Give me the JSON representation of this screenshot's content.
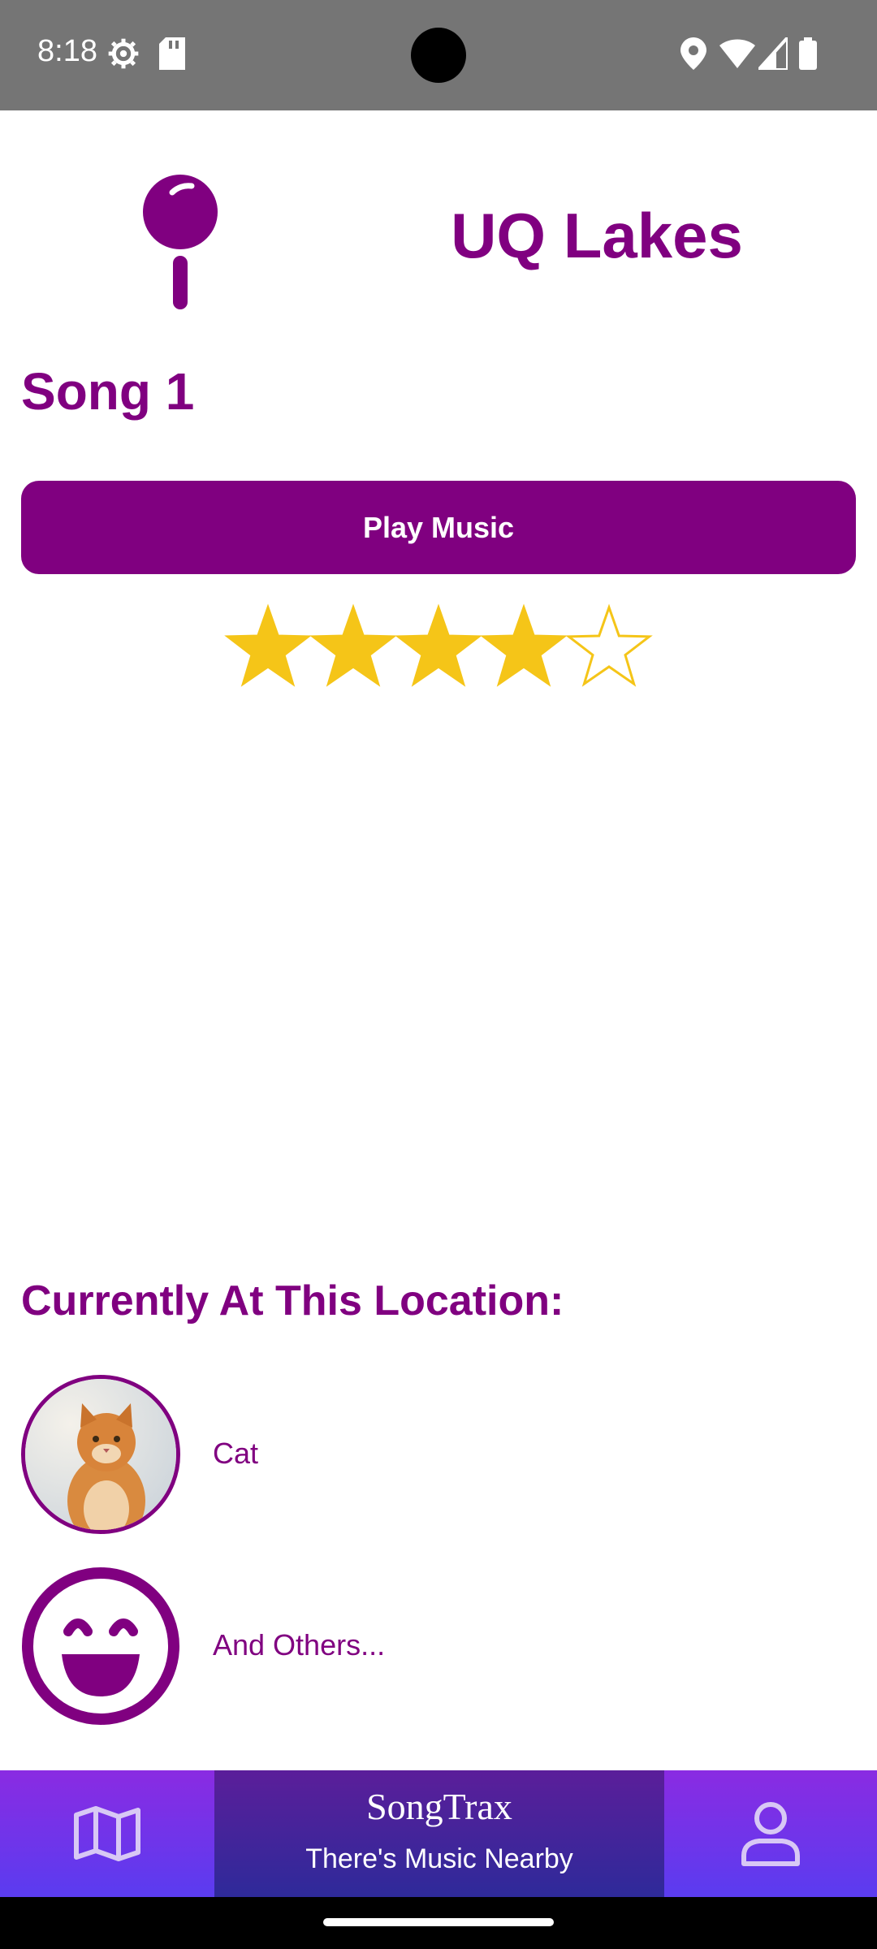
{
  "status_bar": {
    "time": "8:18",
    "icons": [
      "settings-icon",
      "sd-card-icon",
      "location-icon",
      "wifi-icon",
      "signal-icon",
      "battery-icon"
    ]
  },
  "location": {
    "name": "UQ Lakes"
  },
  "song": {
    "title": "Song 1"
  },
  "player": {
    "play_label": "Play Music"
  },
  "rating": {
    "value": 4,
    "max": 5
  },
  "users_section": {
    "heading": "Currently At This Location:",
    "users": [
      {
        "name": "Cat",
        "avatar": "cat-photo"
      },
      {
        "name": "And Others...",
        "avatar": "smiley-face-icon"
      }
    ]
  },
  "bottom_nav": {
    "brand": "SongTrax",
    "tagline": "There's Music Nearby",
    "left_icon": "map-icon",
    "right_icon": "profile-icon"
  },
  "colors": {
    "accent": "#800080",
    "star": "#F5C518",
    "nav_gradient_start": "#8a2be2",
    "nav_gradient_end": "#5a3cf0"
  }
}
